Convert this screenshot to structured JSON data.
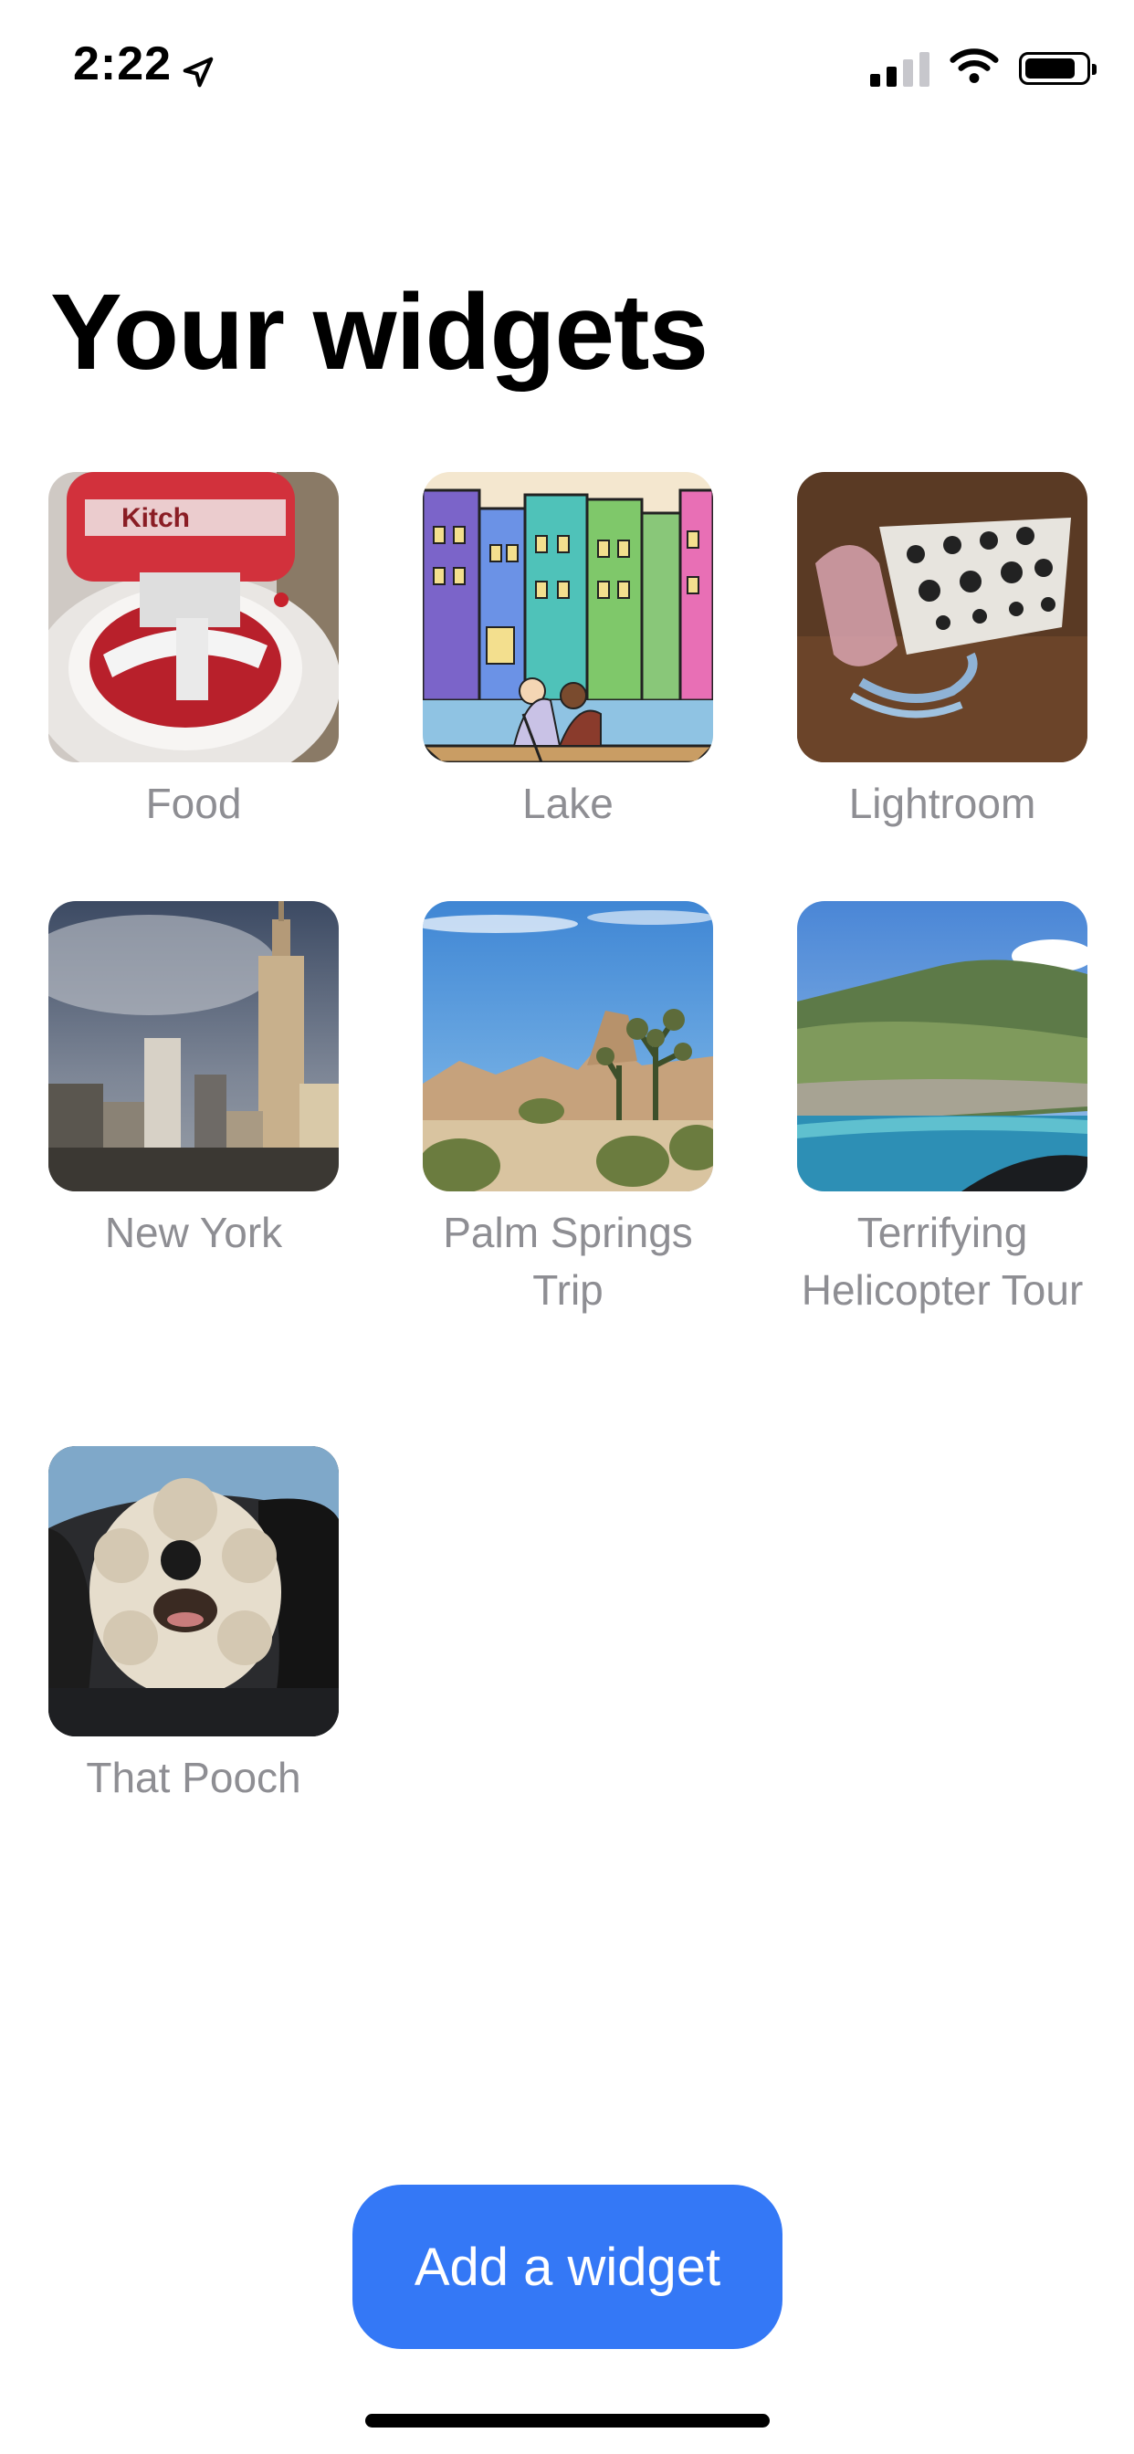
{
  "status_bar": {
    "time": "2:22",
    "icons": [
      "location-arrow-icon",
      "cellular-signal-icon",
      "wifi-icon",
      "battery-icon"
    ]
  },
  "page": {
    "title": "Your widgets"
  },
  "widgets": [
    {
      "label": "Food",
      "image": "stand-mixer-photo"
    },
    {
      "label": "Lake",
      "image": "canal-houses-illustration"
    },
    {
      "label": "Lightroom",
      "image": "modular-synth-photo"
    },
    {
      "label": "New York",
      "image": "empire-state-photo"
    },
    {
      "label": "Palm Springs Trip",
      "image": "desert-joshua-trees-photo"
    },
    {
      "label": "Terrifying Helicopter Tour",
      "image": "aerial-coast-photo"
    },
    {
      "label": "That Pooch",
      "image": "fluffy-dog-photo"
    }
  ],
  "actions": {
    "add_widget_label": "Add a widget"
  },
  "colors": {
    "accent": "#3478f6",
    "label_gray": "#8e8e93"
  }
}
